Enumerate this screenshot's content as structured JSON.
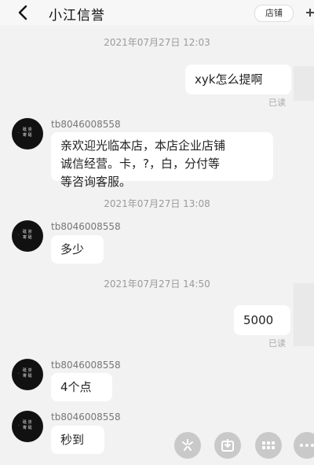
{
  "header": {
    "back_icon": "chevron-left-icon",
    "title": "小江信誉",
    "shop_button": "店铺"
  },
  "messages": {
    "ts1": "2021年07月27日 12:03",
    "m1_text": "xyk怎么提啊",
    "m1_status": "已读",
    "u2_name": "tb8046008558",
    "m2_line1": "亲欢迎光临本店，本店企业店铺",
    "m2_line2": "诚信经营。卡，?，白，分付等",
    "m2_line3": "等咨询客服。",
    "ts2": "2021年07月27日 13:08",
    "u3_name": "tb8046008558",
    "m3_text": "多少",
    "ts3": "2021年07月27日 14:50",
    "m4_text": "5000",
    "m4_status": "已读",
    "u5_name": "tb8046008558",
    "m5_text": "4个点",
    "u6_name": "tb8046008558",
    "m6_text": "秒到"
  },
  "toolbar": {
    "icons": [
      "star-icon",
      "download-icon",
      "keyboard-icon",
      "more-dots-icon"
    ]
  }
}
